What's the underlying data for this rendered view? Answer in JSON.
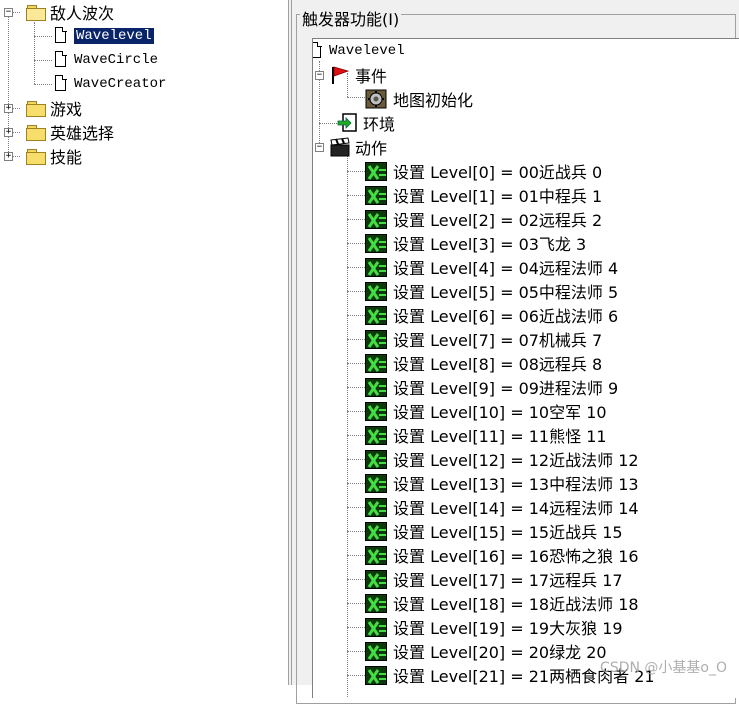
{
  "left_tree": {
    "items": [
      {
        "label": "敌人波次"
      },
      {
        "label": "Wavelevel"
      },
      {
        "label": "WaveCircle"
      },
      {
        "label": "WaveCreator"
      },
      {
        "label": "游戏"
      },
      {
        "label": "英雄选择"
      },
      {
        "label": "技能"
      }
    ]
  },
  "right_panel": {
    "group_title": "触发器功能(I)",
    "root_label": "Wavelevel",
    "events_label": "事件",
    "event_item": "地图初始化",
    "conditions_label": "环境",
    "actions_label": "动作",
    "actions": [
      "设置 Level[0] = 00近战兵 0",
      "设置 Level[1] = 01中程兵 1",
      "设置 Level[2] = 02远程兵 2",
      "设置 Level[3] = 03飞龙 3",
      "设置 Level[4] = 04远程法师 4",
      "设置 Level[5] = 05中程法师 5",
      "设置 Level[6] = 06近战法师 6",
      "设置 Level[7] = 07机械兵 7",
      "设置 Level[8] = 08远程兵 8",
      "设置 Level[9] = 09进程法师 9",
      "设置 Level[10] = 10空军 10",
      "设置 Level[11] = 11熊怪 11",
      "设置 Level[12] = 12近战法师 12",
      "设置 Level[13] = 13中程法师 13",
      "设置 Level[14] = 14远程法师 14",
      "设置 Level[15] = 15近战兵 15",
      "设置 Level[16] = 16恐怖之狼 16",
      "设置 Level[17] = 17远程兵 17",
      "设置 Level[18] = 18近战法师 18",
      "设置 Level[19] = 19大灰狼 19",
      "设置 Level[20] = 20绿龙 20",
      "设置 Level[21] = 21两栖食肉者 21"
    ]
  },
  "watermark": "CSDN @小基基o_O",
  "colors": {
    "selection": "#0a246a",
    "action_icon_bg": "#0a3a0a",
    "action_icon_fg": "#44dd44",
    "event_flag": "#dd1111"
  }
}
